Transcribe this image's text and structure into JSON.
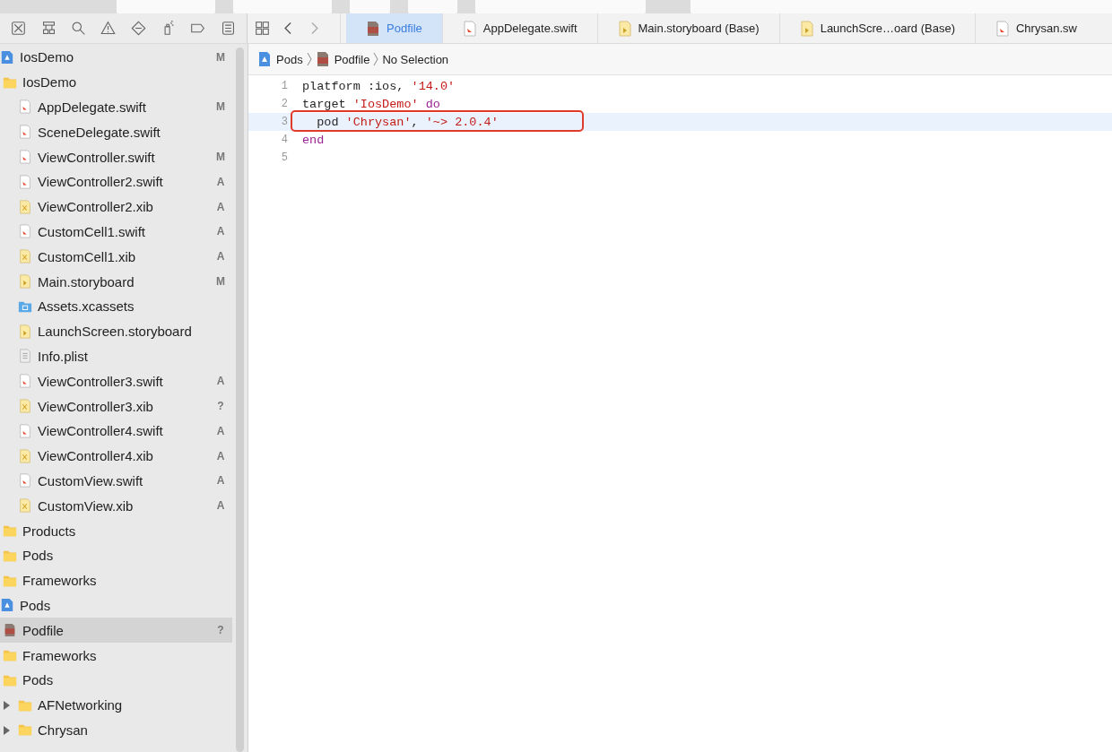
{
  "navigator": {
    "tree": [
      {
        "name": "IosDemo",
        "kind": "project",
        "badge": "M",
        "selected": false,
        "children": [
          {
            "name": "IosDemo",
            "kind": "folder",
            "selected": false,
            "children": [
              {
                "name": "AppDelegate.swift",
                "kind": "swift",
                "badge": "M",
                "selected": false
              },
              {
                "name": "SceneDelegate.swift",
                "kind": "swift",
                "selected": false
              },
              {
                "name": "ViewController.swift",
                "kind": "swift",
                "badge": "M",
                "selected": false
              },
              {
                "name": "ViewController2.swift",
                "kind": "swift",
                "badge": "A",
                "selected": false
              },
              {
                "name": "ViewController2.xib",
                "kind": "xib",
                "badge": "A",
                "selected": false
              },
              {
                "name": "CustomCell1.swift",
                "kind": "swift",
                "badge": "A",
                "selected": false
              },
              {
                "name": "CustomCell1.xib",
                "kind": "xib",
                "badge": "A",
                "selected": false
              },
              {
                "name": "Main.storyboard",
                "kind": "storyboard",
                "badge": "M",
                "selected": false
              },
              {
                "name": "Assets.xcassets",
                "kind": "assets",
                "selected": false
              },
              {
                "name": "LaunchScreen.storyboard",
                "kind": "storyboard",
                "selected": false
              },
              {
                "name": "Info.plist",
                "kind": "plist",
                "selected": false
              },
              {
                "name": "ViewController3.swift",
                "kind": "swift",
                "badge": "A",
                "selected": false
              },
              {
                "name": "ViewController3.xib",
                "kind": "xib",
                "badge": "?",
                "selected": false
              },
              {
                "name": "ViewController4.swift",
                "kind": "swift",
                "badge": "A",
                "selected": false
              },
              {
                "name": "ViewController4.xib",
                "kind": "xib",
                "badge": "A",
                "selected": false
              },
              {
                "name": "CustomView.swift",
                "kind": "swift",
                "badge": "A",
                "selected": false
              },
              {
                "name": "CustomView.xib",
                "kind": "xib",
                "badge": "A",
                "selected": false
              }
            ]
          },
          {
            "name": "Products",
            "kind": "folder",
            "selected": false
          },
          {
            "name": "Pods",
            "kind": "folder",
            "selected": false
          },
          {
            "name": "Frameworks",
            "kind": "folder",
            "selected": false
          }
        ]
      },
      {
        "name": "Pods",
        "kind": "project",
        "selected": false,
        "children": [
          {
            "name": "Podfile",
            "kind": "podfile",
            "badge": "?",
            "selected": true
          },
          {
            "name": "Frameworks",
            "kind": "folder",
            "selected": false
          },
          {
            "name": "Pods",
            "kind": "folder",
            "selected": false,
            "children": [
              {
                "name": "AFNetworking",
                "kind": "folder",
                "selected": false,
                "expanded": false
              },
              {
                "name": "Chrysan",
                "kind": "folder",
                "selected": false,
                "expanded": false
              }
            ]
          }
        ]
      }
    ]
  },
  "tabs": [
    {
      "label": "Podfile",
      "kind": "podfile",
      "selected": true
    },
    {
      "label": "AppDelegate.swift",
      "kind": "swift",
      "selected": false
    },
    {
      "label": "Main.storyboard (Base)",
      "kind": "storyboard",
      "selected": false
    },
    {
      "label": "LaunchScre…oard (Base)",
      "kind": "storyboard",
      "selected": false
    },
    {
      "label": "Chrysan.sw",
      "kind": "swift",
      "selected": false
    }
  ],
  "breadcrumb": [
    {
      "label": "Pods",
      "kind": "project"
    },
    {
      "label": "Podfile",
      "kind": "podfile"
    },
    {
      "label": "No Selection",
      "kind": "none"
    }
  ],
  "editor": {
    "lines": [
      {
        "number": "1",
        "current": false,
        "boxed": false,
        "tokens": [
          {
            "text": "platform :ios, ",
            "kind": "plain"
          },
          {
            "text": "'14.0'",
            "kind": "string"
          }
        ]
      },
      {
        "number": "2",
        "current": false,
        "boxed": false,
        "tokens": [
          {
            "text": "target ",
            "kind": "plain"
          },
          {
            "text": "'IosDemo'",
            "kind": "string"
          },
          {
            "text": " do",
            "kind": "keyword"
          }
        ]
      },
      {
        "number": "3",
        "current": true,
        "boxed": true,
        "tokens": [
          {
            "text": "  pod ",
            "kind": "plain"
          },
          {
            "text": "'Chrysan'",
            "kind": "string"
          },
          {
            "text": ", ",
            "kind": "plain"
          },
          {
            "text": "'~> 2.0.4'",
            "kind": "string"
          }
        ]
      },
      {
        "number": "4",
        "current": false,
        "boxed": false,
        "tokens": [
          {
            "text": "end",
            "kind": "keyword"
          }
        ]
      },
      {
        "number": "5",
        "current": false,
        "boxed": false
      }
    ]
  }
}
